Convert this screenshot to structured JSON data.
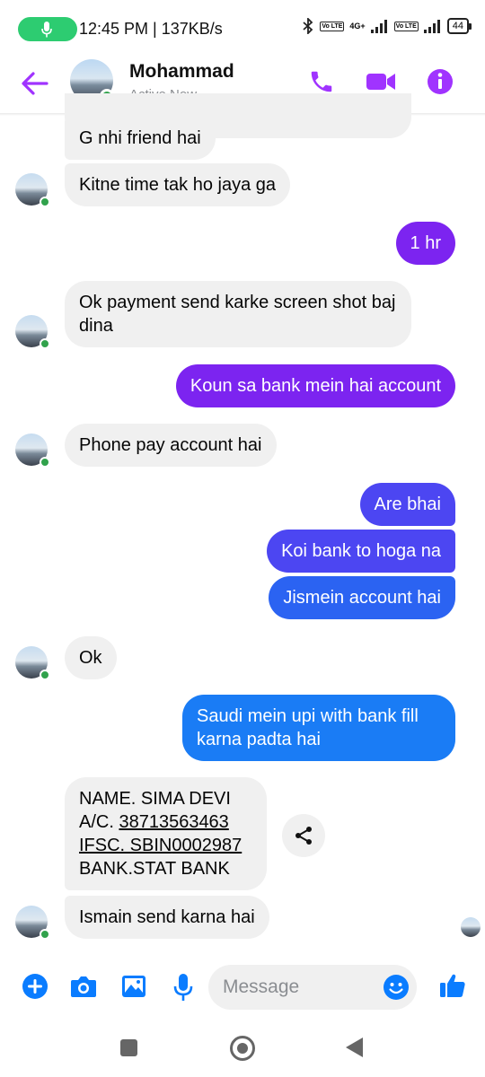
{
  "status_bar": {
    "time_speed": "12:45 PM | 137KB/s",
    "network_type": "4G+",
    "volte1": "Vo LTE",
    "volte2": "Vo LTE",
    "battery": "44"
  },
  "header": {
    "contact_name": "Mohammad",
    "contact_status": "Active Now",
    "accent_color": "#a033ff"
  },
  "messages": [
    {
      "from": "them",
      "text": "G nhi friend hai"
    },
    {
      "from": "them",
      "text": "Kitne time tak ho jaya ga"
    },
    {
      "from": "me",
      "text": "1 hr"
    },
    {
      "from": "them",
      "text": "Ok payment send karke screen shot baj dina"
    },
    {
      "from": "me",
      "text": "Koun sa bank mein hai account"
    },
    {
      "from": "them",
      "text": "Phone pay account hai"
    },
    {
      "from": "me",
      "text": "Are bhai"
    },
    {
      "from": "me",
      "text": "Koi bank to hoga na"
    },
    {
      "from": "me",
      "text": "Jismein account hai"
    },
    {
      "from": "them",
      "text": "Ok"
    },
    {
      "from": "me",
      "text": "Saudi mein upi with bank fill karna padta hai"
    },
    {
      "from": "them",
      "lines": {
        "name": "NAME. SIMA DEVI",
        "ac_label": "A/C. ",
        "ac_number": "38713563463",
        "ifsc_label": "IFSC. SBIN",
        "ifsc_code": "0002987",
        "bank": "BANK.STAT BANK"
      }
    },
    {
      "from": "them",
      "text": "Ismain send karna hai"
    }
  ],
  "composer": {
    "placeholder": "Message",
    "icon_color": "#0a7cff"
  },
  "icons": [
    "microphone-icon",
    "bluetooth-icon",
    "signal-icon",
    "back-arrow-icon",
    "phone-icon",
    "video-camera-icon",
    "info-icon",
    "plus-icon",
    "camera-icon",
    "image-icon",
    "microphone-icon",
    "emoji-icon",
    "thumbs-up-icon",
    "share-icon"
  ]
}
